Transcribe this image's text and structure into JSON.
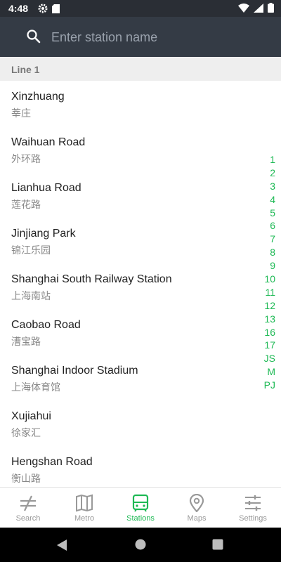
{
  "status": {
    "time": "4:48"
  },
  "search": {
    "placeholder": "Enter station name"
  },
  "section": {
    "title": "Line 1"
  },
  "stations": [
    {
      "name": "Xinzhuang",
      "chinese": "莘庄"
    },
    {
      "name": "Waihuan Road",
      "chinese": "外环路"
    },
    {
      "name": "Lianhua Road",
      "chinese": "莲花路"
    },
    {
      "name": "Jinjiang Park",
      "chinese": "锦江乐园"
    },
    {
      "name": "Shanghai South Railway Station",
      "chinese": "上海南站"
    },
    {
      "name": "Caobao Road",
      "chinese": "漕宝路"
    },
    {
      "name": "Shanghai Indoor Stadium",
      "chinese": "上海体育馆"
    },
    {
      "name": "Xujiahui",
      "chinese": "徐家汇"
    },
    {
      "name": "Hengshan Road",
      "chinese": "衡山路"
    }
  ],
  "line_index": [
    "1",
    "2",
    "3",
    "4",
    "5",
    "6",
    "7",
    "8",
    "9",
    "10",
    "11",
    "12",
    "13",
    "16",
    "17",
    "JS",
    "M",
    "PJ"
  ],
  "nav": {
    "items": [
      {
        "label": "Search",
        "icon": "search-lines-icon"
      },
      {
        "label": "Metro",
        "icon": "map-book-icon"
      },
      {
        "label": "Stations",
        "icon": "train-icon"
      },
      {
        "label": "Maps",
        "icon": "location-pin-icon"
      },
      {
        "label": "Settings",
        "icon": "sliders-icon"
      }
    ],
    "active": "Stations"
  },
  "colors": {
    "accent": "#1db954",
    "header": "#343b45",
    "statusbar": "#2a2e35"
  }
}
